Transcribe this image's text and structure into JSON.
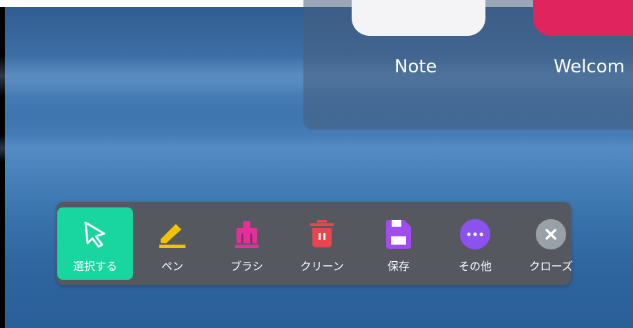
{
  "apps": [
    {
      "label": "Note",
      "icon": "note-app-icon",
      "color": "#f4f4f6"
    },
    {
      "label": "Welcom",
      "icon": "welcome-app-icon",
      "color": "#e0245e"
    }
  ],
  "toolbar": {
    "tools": [
      {
        "label": "選択する",
        "icon": "cursor-select-icon",
        "color": "#ffffff",
        "active": true
      },
      {
        "label": "ペン",
        "icon": "pen-icon",
        "color": "#f2c200"
      },
      {
        "label": "ブラシ",
        "icon": "brush-icon",
        "color": "#e0309a"
      },
      {
        "label": "クリーン",
        "icon": "trash-icon",
        "color": "#e8454f"
      },
      {
        "label": "保存",
        "icon": "save-icon",
        "color": "#a24bf0"
      },
      {
        "label": "その他",
        "icon": "more-icon",
        "color": "#8b52f0"
      },
      {
        "label": "クローズ",
        "icon": "close-icon",
        "color": "#9aa0a8"
      }
    ],
    "background": "#55585f",
    "active_color": "#19d59f"
  }
}
